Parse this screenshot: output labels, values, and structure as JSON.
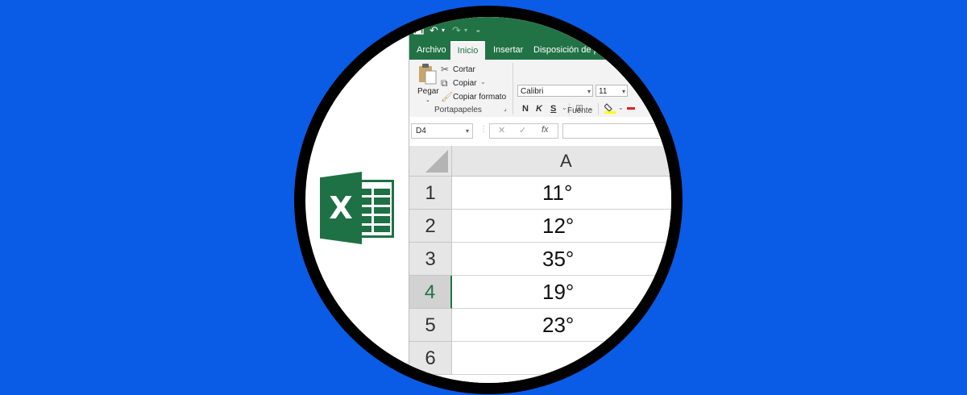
{
  "quick_access": {
    "save_icon": "save-icon",
    "undo_icon": "undo-icon",
    "redo_icon": "redo-icon",
    "customize_icon": "customize-icon"
  },
  "tabs": [
    {
      "label": "Archivo"
    },
    {
      "label": "Inicio",
      "active": true
    },
    {
      "label": "Insertar"
    },
    {
      "label": "Disposición de pág"
    }
  ],
  "ribbon": {
    "clipboard": {
      "paste_label": "Pegar",
      "cut_label": "Cortar",
      "copy_label": "Copiar",
      "format_painter_label": "Copiar formato",
      "group_name": "Portapapeles"
    },
    "font": {
      "font_name": "Calibri",
      "font_size": "11",
      "bold": "N",
      "italic": "K",
      "underline": "S",
      "group_name": "Fuente"
    }
  },
  "formula_bar": {
    "name_box": "D4",
    "fx_label": "fx",
    "cancel_symbol": "✕",
    "enter_symbol": "✓"
  },
  "grid": {
    "column_header": "A",
    "rows": [
      {
        "num": "1",
        "value": "11°"
      },
      {
        "num": "2",
        "value": "12°"
      },
      {
        "num": "3",
        "value": "35°"
      },
      {
        "num": "4",
        "value": "19°",
        "selected": true
      },
      {
        "num": "5",
        "value": "23°"
      },
      {
        "num": "6",
        "value": ""
      }
    ]
  },
  "colors": {
    "background": "#0a5ce6",
    "excel_green": "#217346",
    "logo_green": "#1e7145"
  }
}
